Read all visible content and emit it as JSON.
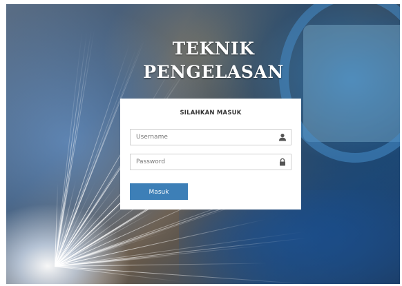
{
  "page": {
    "title_line_1": "TEKNIK",
    "title_line_2": "PENGELASAN"
  },
  "login": {
    "heading": "SILAHKAN MASUK",
    "username": {
      "placeholder": "Username",
      "value": "",
      "icon": "user-icon"
    },
    "password": {
      "placeholder": "Password",
      "value": "",
      "icon": "lock-icon"
    },
    "submit_label": "Masuk"
  },
  "colors": {
    "button": "#3d7fb7",
    "panel": "#ffffff",
    "title": "#ffffff"
  }
}
